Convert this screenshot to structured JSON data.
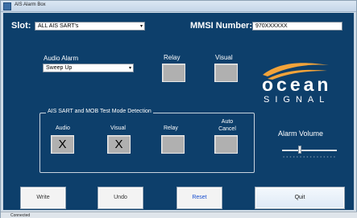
{
  "window": {
    "title": "AIS Alarm Box"
  },
  "slot": {
    "label": "Slot:",
    "value": "ALL AIS SART's"
  },
  "mmsi": {
    "label": "MMSI Number:",
    "value": "970XXXXXX"
  },
  "audio_alarm": {
    "label": "Audio Alarm",
    "value": "Sweep Up"
  },
  "outputs": {
    "relay_label": "Relay",
    "visual_label": "Visual",
    "relay_checked": false,
    "visual_checked": false
  },
  "test_mode": {
    "title": "AIS SART and MOB Test Mode Detection",
    "audio_label": "Audio",
    "visual_label": "Visual",
    "relay_label": "Relay",
    "auto_cancel_label": "Auto\nCancel",
    "audio_mark": "X",
    "visual_mark": "X",
    "relay_mark": "",
    "auto_cancel_mark": ""
  },
  "logo": {
    "word": "ocean",
    "sub": "SIGNAL"
  },
  "alarm_volume": {
    "label": "Alarm Volume",
    "level": 0.33
  },
  "buttons": {
    "write": "Write",
    "undo": "Undo",
    "reset": "Reset",
    "quit": "Quit"
  },
  "status": {
    "text": "Connected"
  },
  "colors": {
    "panel": "#0d3f6b",
    "window": "#cfdbe6",
    "reset_text": "#1a4fcf",
    "logo_wave": "#f2a33a"
  }
}
